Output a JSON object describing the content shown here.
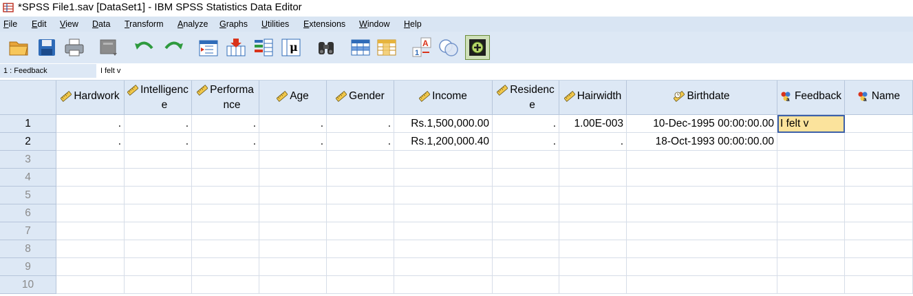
{
  "window": {
    "title": "*SPSS File1.sav [DataSet1] - IBM SPSS Statistics Data Editor"
  },
  "menu": [
    {
      "label": "File"
    },
    {
      "label": "Edit"
    },
    {
      "label": "View"
    },
    {
      "label": "Data"
    },
    {
      "label": "Transform"
    },
    {
      "label": "Analyze"
    },
    {
      "label": "Graphs"
    },
    {
      "label": "Utilities"
    },
    {
      "label": "Extensions"
    },
    {
      "label": "Window"
    },
    {
      "label": "Help"
    }
  ],
  "toolbar": {
    "icons": [
      "open-folder-icon",
      "save-icon",
      "print-icon",
      "dialog-recall-icon",
      "undo-icon",
      "redo-icon",
      "goto-case-icon",
      "goto-variable-icon",
      "variables-icon",
      "run-descriptives-icon",
      "find-icon",
      "insert-cases-icon",
      "insert-variable-icon",
      "value-labels-icon",
      "use-sets-icon",
      "add-icon"
    ]
  },
  "cellbar": {
    "reference": "1 : Feedback",
    "value": "I felt v"
  },
  "grid": {
    "columns": [
      {
        "label": "Hardwork",
        "type": "scale"
      },
      {
        "label": "Intelligenc e",
        "line1": "Intelligenc",
        "line2": "e",
        "type": "scale"
      },
      {
        "label": "Performa nce",
        "line1": "Performa",
        "line2": "nce",
        "type": "scale"
      },
      {
        "label": "Age",
        "type": "scale"
      },
      {
        "label": "Gender",
        "type": "scale"
      },
      {
        "label": "Income",
        "type": "scale"
      },
      {
        "label": "Residenc e",
        "line1": "Residenc",
        "line2": "e",
        "type": "scale"
      },
      {
        "label": "Hairwidth",
        "type": "scale"
      },
      {
        "label": "Birthdate",
        "type": "scale-date"
      },
      {
        "label": "Feedback",
        "type": "nominal"
      },
      {
        "label": "Name",
        "type": "nominal"
      }
    ],
    "rows": [
      {
        "num": "1",
        "cells": [
          ".",
          ".",
          ".",
          ".",
          ".",
          "Rs.1,500,000.00",
          ".",
          "1.00E-003",
          "10-Dec-1995 00:00:00.00",
          "I felt v",
          ""
        ]
      },
      {
        "num": "2",
        "cells": [
          ".",
          ".",
          ".",
          ".",
          ".",
          "Rs.1,200,000.40",
          ".",
          ".",
          "18-Oct-1993 00:00:00.00",
          "",
          ""
        ]
      },
      {
        "num": "3",
        "cells": [
          "",
          "",
          "",
          "",
          "",
          "",
          "",
          "",
          "",
          "",
          ""
        ]
      },
      {
        "num": "4",
        "cells": [
          "",
          "",
          "",
          "",
          "",
          "",
          "",
          "",
          "",
          "",
          ""
        ]
      },
      {
        "num": "5",
        "cells": [
          "",
          "",
          "",
          "",
          "",
          "",
          "",
          "",
          "",
          "",
          ""
        ]
      },
      {
        "num": "6",
        "cells": [
          "",
          "",
          "",
          "",
          "",
          "",
          "",
          "",
          "",
          "",
          ""
        ]
      },
      {
        "num": "7",
        "cells": [
          "",
          "",
          "",
          "",
          "",
          "",
          "",
          "",
          "",
          "",
          ""
        ]
      },
      {
        "num": "8",
        "cells": [
          "",
          "",
          "",
          "",
          "",
          "",
          "",
          "",
          "",
          "",
          ""
        ]
      },
      {
        "num": "9",
        "cells": [
          "",
          "",
          "",
          "",
          "",
          "",
          "",
          "",
          "",
          "",
          ""
        ]
      },
      {
        "num": "10",
        "cells": [
          "",
          "",
          "",
          "",
          "",
          "",
          "",
          "",
          "",
          "",
          ""
        ]
      }
    ],
    "active_cell": {
      "row": 0,
      "col": 9
    },
    "colors": {
      "header_bg": "#dde8f5",
      "active_bg": "#fbe39c",
      "active_border": "#3b5fa8"
    }
  }
}
